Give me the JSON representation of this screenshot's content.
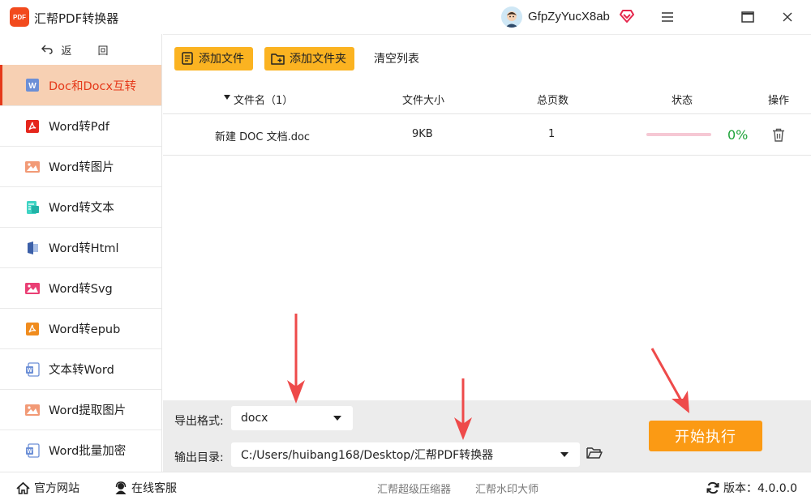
{
  "titlebar": {
    "logo_text": "PDF",
    "title": "汇帮PDF转换器",
    "username": "GfpZyYucX8ab"
  },
  "sidebar": {
    "back_label": "返 回",
    "items": [
      {
        "label": "Doc和Docx互转",
        "icon": "word-doc-icon",
        "active": true
      },
      {
        "label": "Word转Pdf",
        "icon": "pdf-icon"
      },
      {
        "label": "Word转图片",
        "icon": "image-icon"
      },
      {
        "label": "Word转文本",
        "icon": "text-icon"
      },
      {
        "label": "Word转Html",
        "icon": "html-icon"
      },
      {
        "label": "Word转Svg",
        "icon": "svg-icon"
      },
      {
        "label": "Word转epub",
        "icon": "epub-icon"
      },
      {
        "label": "文本转Word",
        "icon": "word-icon"
      },
      {
        "label": "Word提取图片",
        "icon": "image-extract-icon"
      },
      {
        "label": "Word批量加密",
        "icon": "word-lock-icon"
      }
    ]
  },
  "toolbar": {
    "add_file": "添加文件",
    "add_folder": "添加文件夹",
    "clear_list": "清空列表"
  },
  "table": {
    "headers": {
      "name": "文件名（1）",
      "size": "文件大小",
      "pages": "总页数",
      "status": "状态",
      "action": "操作"
    },
    "rows": [
      {
        "name": "新建 DOC 文档.doc",
        "size": "9KB",
        "pages": "1",
        "progress_percent": 0,
        "progress_text": "0%"
      }
    ]
  },
  "settings": {
    "format_label": "导出格式:",
    "format_value": "docx",
    "dir_label": "输出目录:",
    "dir_value": "C:/Users/huibang168/Desktop/汇帮PDF转换器",
    "start_label": "开始执行"
  },
  "footer": {
    "website": "官方网站",
    "service": "在线客服",
    "link1": "汇帮超级压缩器",
    "link2": "汇帮水印大师",
    "version": "版本：4.0.0.0"
  },
  "colors": {
    "accent_orange": "#fbb321",
    "start_orange": "#fb9a14",
    "active_bg": "#f7d0b3",
    "active_text": "#e5391a",
    "progress_green": "#1fa33a",
    "arrow_red": "#ee4a4a"
  }
}
